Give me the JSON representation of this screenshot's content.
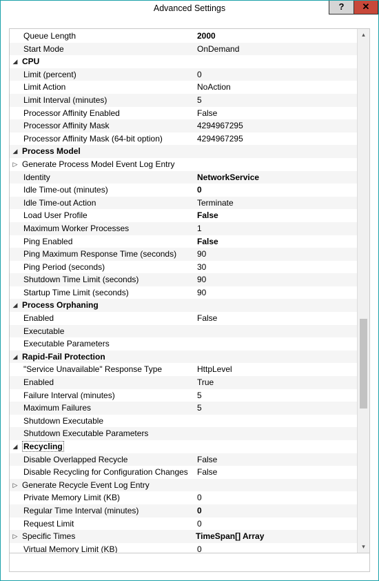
{
  "window": {
    "title": "Advanced Settings"
  },
  "rows": [
    {
      "type": "item",
      "label": "Queue Length",
      "value": "2000",
      "boldValue": true,
      "alt": false
    },
    {
      "type": "item",
      "label": "Start Mode",
      "value": "OnDemand",
      "alt": true
    },
    {
      "type": "cat",
      "label": "CPU",
      "alt": false,
      "exp": "◢"
    },
    {
      "type": "item",
      "label": "Limit (percent)",
      "value": "0",
      "alt": true
    },
    {
      "type": "item",
      "label": "Limit Action",
      "value": "NoAction",
      "alt": false
    },
    {
      "type": "item",
      "label": "Limit Interval (minutes)",
      "value": "5",
      "alt": true
    },
    {
      "type": "item",
      "label": "Processor Affinity Enabled",
      "value": "False",
      "alt": false
    },
    {
      "type": "item",
      "label": "Processor Affinity Mask",
      "value": "4294967295",
      "alt": true
    },
    {
      "type": "item",
      "label": "Processor Affinity Mask (64-bit option)",
      "value": "4294967295",
      "alt": false
    },
    {
      "type": "cat",
      "label": "Process Model",
      "alt": true,
      "exp": "◢"
    },
    {
      "type": "sub",
      "label": "Generate Process Model Event Log Entry",
      "value": "",
      "alt": false,
      "exp": "▷"
    },
    {
      "type": "item",
      "label": "Identity",
      "value": "NetworkService",
      "boldValue": true,
      "alt": true
    },
    {
      "type": "item",
      "label": "Idle Time-out (minutes)",
      "value": "0",
      "boldValue": true,
      "alt": false
    },
    {
      "type": "item",
      "label": "Idle Time-out Action",
      "value": "Terminate",
      "alt": true
    },
    {
      "type": "item",
      "label": "Load User Profile",
      "value": "False",
      "boldValue": true,
      "alt": false
    },
    {
      "type": "item",
      "label": "Maximum Worker Processes",
      "value": "1",
      "alt": true
    },
    {
      "type": "item",
      "label": "Ping Enabled",
      "value": "False",
      "boldValue": true,
      "alt": false
    },
    {
      "type": "item",
      "label": "Ping Maximum Response Time (seconds)",
      "value": "90",
      "alt": true
    },
    {
      "type": "item",
      "label": "Ping Period (seconds)",
      "value": "30",
      "alt": false
    },
    {
      "type": "item",
      "label": "Shutdown Time Limit (seconds)",
      "value": "90",
      "alt": true
    },
    {
      "type": "item",
      "label": "Startup Time Limit (seconds)",
      "value": "90",
      "alt": false
    },
    {
      "type": "cat",
      "label": "Process Orphaning",
      "alt": true,
      "exp": "◢"
    },
    {
      "type": "item",
      "label": "Enabled",
      "value": "False",
      "alt": false
    },
    {
      "type": "item",
      "label": "Executable",
      "value": "",
      "alt": true
    },
    {
      "type": "item",
      "label": "Executable Parameters",
      "value": "",
      "alt": false
    },
    {
      "type": "cat",
      "label": "Rapid-Fail Protection",
      "alt": true,
      "exp": "◢"
    },
    {
      "type": "item",
      "label": "\"Service Unavailable\" Response Type",
      "value": "HttpLevel",
      "alt": false
    },
    {
      "type": "item",
      "label": "Enabled",
      "value": "True",
      "alt": true
    },
    {
      "type": "item",
      "label": "Failure Interval (minutes)",
      "value": "5",
      "alt": false
    },
    {
      "type": "item",
      "label": "Maximum Failures",
      "value": "5",
      "alt": true
    },
    {
      "type": "item",
      "label": "Shutdown Executable",
      "value": "",
      "alt": false
    },
    {
      "type": "item",
      "label": "Shutdown Executable Parameters",
      "value": "",
      "alt": true
    },
    {
      "type": "cat",
      "label": "Recycling",
      "alt": false,
      "exp": "◢",
      "selected": true
    },
    {
      "type": "item",
      "label": "Disable Overlapped Recycle",
      "value": "False",
      "alt": true
    },
    {
      "type": "item",
      "label": "Disable Recycling for Configuration Changes",
      "value": "False",
      "alt": false
    },
    {
      "type": "sub",
      "label": "Generate Recycle Event Log Entry",
      "value": "",
      "alt": true,
      "exp": "▷"
    },
    {
      "type": "item",
      "label": "Private Memory Limit (KB)",
      "value": "0",
      "alt": false
    },
    {
      "type": "item",
      "label": "Regular Time Interval (minutes)",
      "value": "0",
      "boldValue": true,
      "alt": true
    },
    {
      "type": "item",
      "label": "Request Limit",
      "value": "0",
      "alt": false
    },
    {
      "type": "sub",
      "label": "Specific Times",
      "value": "TimeSpan[] Array",
      "boldValue": true,
      "alt": true,
      "exp": "▷"
    },
    {
      "type": "item",
      "label": "Virtual Memory Limit (KB)",
      "value": "0",
      "alt": false
    }
  ]
}
